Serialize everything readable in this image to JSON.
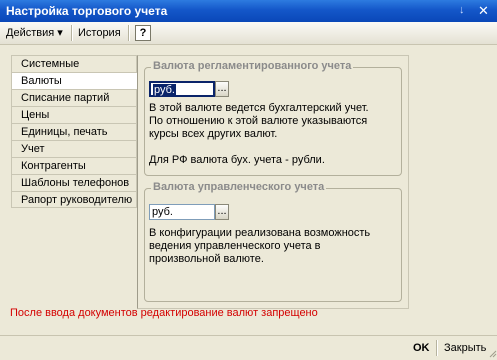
{
  "window": {
    "title": "Настройка торгового учета",
    "pin": "↓",
    "close": "✕"
  },
  "toolbar": {
    "actions": "Действия ▾",
    "history": "История",
    "help": "?"
  },
  "tabs": [
    {
      "label": "Системные"
    },
    {
      "label": "Валюты"
    },
    {
      "label": "Списание партий"
    },
    {
      "label": "Цены"
    },
    {
      "label": "Единицы, печать"
    },
    {
      "label": "Учет"
    },
    {
      "label": "Контрагенты"
    },
    {
      "label": "Шаблоны телефонов"
    },
    {
      "label": "Рапорт руководителю"
    }
  ],
  "active_tab": "Валюты",
  "regulated": {
    "title": "Валюта регламентированного учета",
    "value": "руб.",
    "line1": "В этой валюте ведется бухгалтерский учет.",
    "line2": "По отношению к этой валюте указываются курсы всех других валют.",
    "line3": "Для РФ валюта бух. учета - рубли."
  },
  "management": {
    "title": "Валюта управленческого учета",
    "value": "руб.",
    "line1": "В конфигурации реализована возможность ведения управленческого учета в произвольной валюте."
  },
  "select_button": "...",
  "warning": "После ввода документов редактирование валют запрещено",
  "footer": {
    "ok": "OK",
    "close": "Закрыть"
  }
}
